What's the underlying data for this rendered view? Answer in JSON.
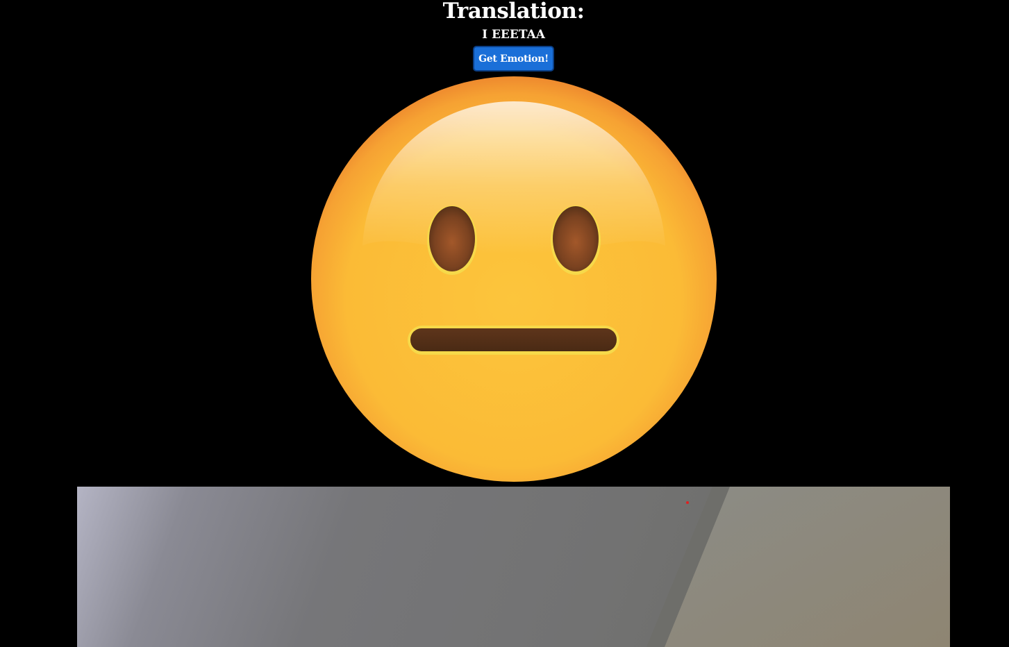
{
  "header": {
    "title": "Translation:",
    "translation_text": "I EEETAA"
  },
  "actions": {
    "get_emotion_label": "Get Emotion!"
  },
  "emotion": {
    "icon": "neutral-face-icon"
  },
  "camera": {
    "icon": "webcam-feed"
  },
  "colors": {
    "background": "#000000",
    "button": "#1a6fd8",
    "button_border": "#0b3f86",
    "emoji_face": "#fbbf39",
    "emoji_features": "#5a341a"
  }
}
